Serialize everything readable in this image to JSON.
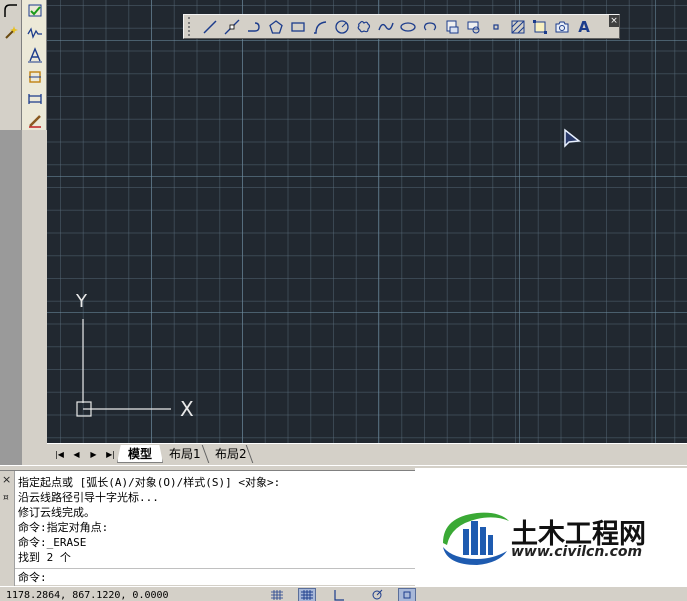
{
  "tools_left": [
    {
      "icon": "fillet-icon"
    },
    {
      "icon": "magic-wand-icon"
    }
  ],
  "tools_dim": [
    {
      "icon": "check-dimension-icon"
    },
    {
      "icon": "break-dimension-icon"
    },
    {
      "icon": "dimension-text-icon"
    },
    {
      "icon": "baseline-dimension-icon"
    },
    {
      "icon": "continue-dimension-icon"
    },
    {
      "icon": "dimension-style-brush-icon"
    }
  ],
  "draw_toolbar": {
    "tools": [
      {
        "icon": "line-icon"
      },
      {
        "icon": "construction-line-icon"
      },
      {
        "icon": "polyline-icon"
      },
      {
        "icon": "polygon-icon"
      },
      {
        "icon": "rectangle-icon"
      },
      {
        "icon": "arc-icon"
      },
      {
        "icon": "circle-icon"
      },
      {
        "icon": "revision-cloud-icon"
      },
      {
        "icon": "spline-icon"
      },
      {
        "icon": "ellipse-icon"
      },
      {
        "icon": "ellipse-arc-icon"
      },
      {
        "icon": "insert-block-icon"
      },
      {
        "icon": "make-block-icon"
      },
      {
        "icon": "point-icon"
      },
      {
        "icon": "hatch-icon"
      },
      {
        "icon": "gradient-icon"
      },
      {
        "icon": "region-icon"
      },
      {
        "icon": "multiline-text-icon",
        "glyph": "A"
      }
    ],
    "close_glyph": "×"
  },
  "ucs": {
    "y_label": "Y",
    "x_label": "X"
  },
  "tabs": {
    "model": "模型",
    "layout1": "布局1",
    "layout2": "布局2"
  },
  "command": {
    "lines": [
      "指定起点或 [弧长(A)/对象(O)/样式(S)] <对象>:",
      "沿云线路径引导十字光标...",
      "修订云线完成。",
      "命令:指定对角点:",
      "命令:_ERASE",
      "找到 2 个"
    ],
    "prompt": "命令:",
    "close_glyph": "×",
    "pin_glyph": "¤"
  },
  "watermark": {
    "name": "土木工程网",
    "url": "www.civilcn.com"
  },
  "status": {
    "coords": "1178.2864, 867.1220, 0.0000"
  },
  "colors": {
    "canvas": "#212830",
    "grid": "#5a6e7d",
    "logo_blue": "#1e5bb0",
    "logo_green": "#3aa935"
  }
}
